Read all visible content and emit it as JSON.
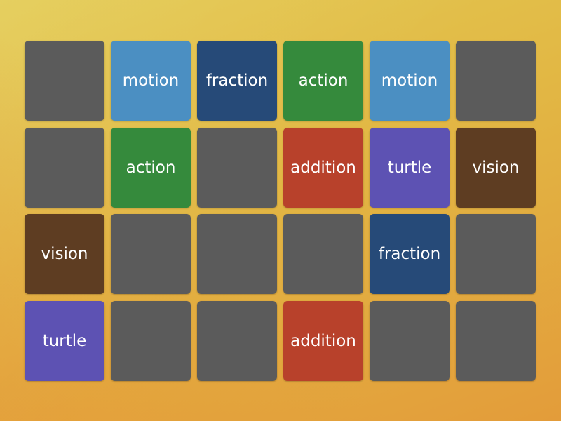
{
  "colors": {
    "hidden": "#5b5b5b",
    "motion": "#4b8fc2",
    "fraction": "#264a78",
    "action": "#358a3c",
    "addition": "#b8412b",
    "turtle": "#5d52b3",
    "vision": "#5e3d22"
  },
  "board": {
    "rows": [
      [
        null,
        "motion",
        "fraction",
        "action",
        "motion",
        null
      ],
      [
        null,
        "action",
        null,
        "addition",
        "turtle",
        "vision"
      ],
      [
        "vision",
        null,
        null,
        null,
        "fraction",
        null
      ],
      [
        "turtle",
        null,
        null,
        "addition",
        null,
        null
      ]
    ]
  }
}
